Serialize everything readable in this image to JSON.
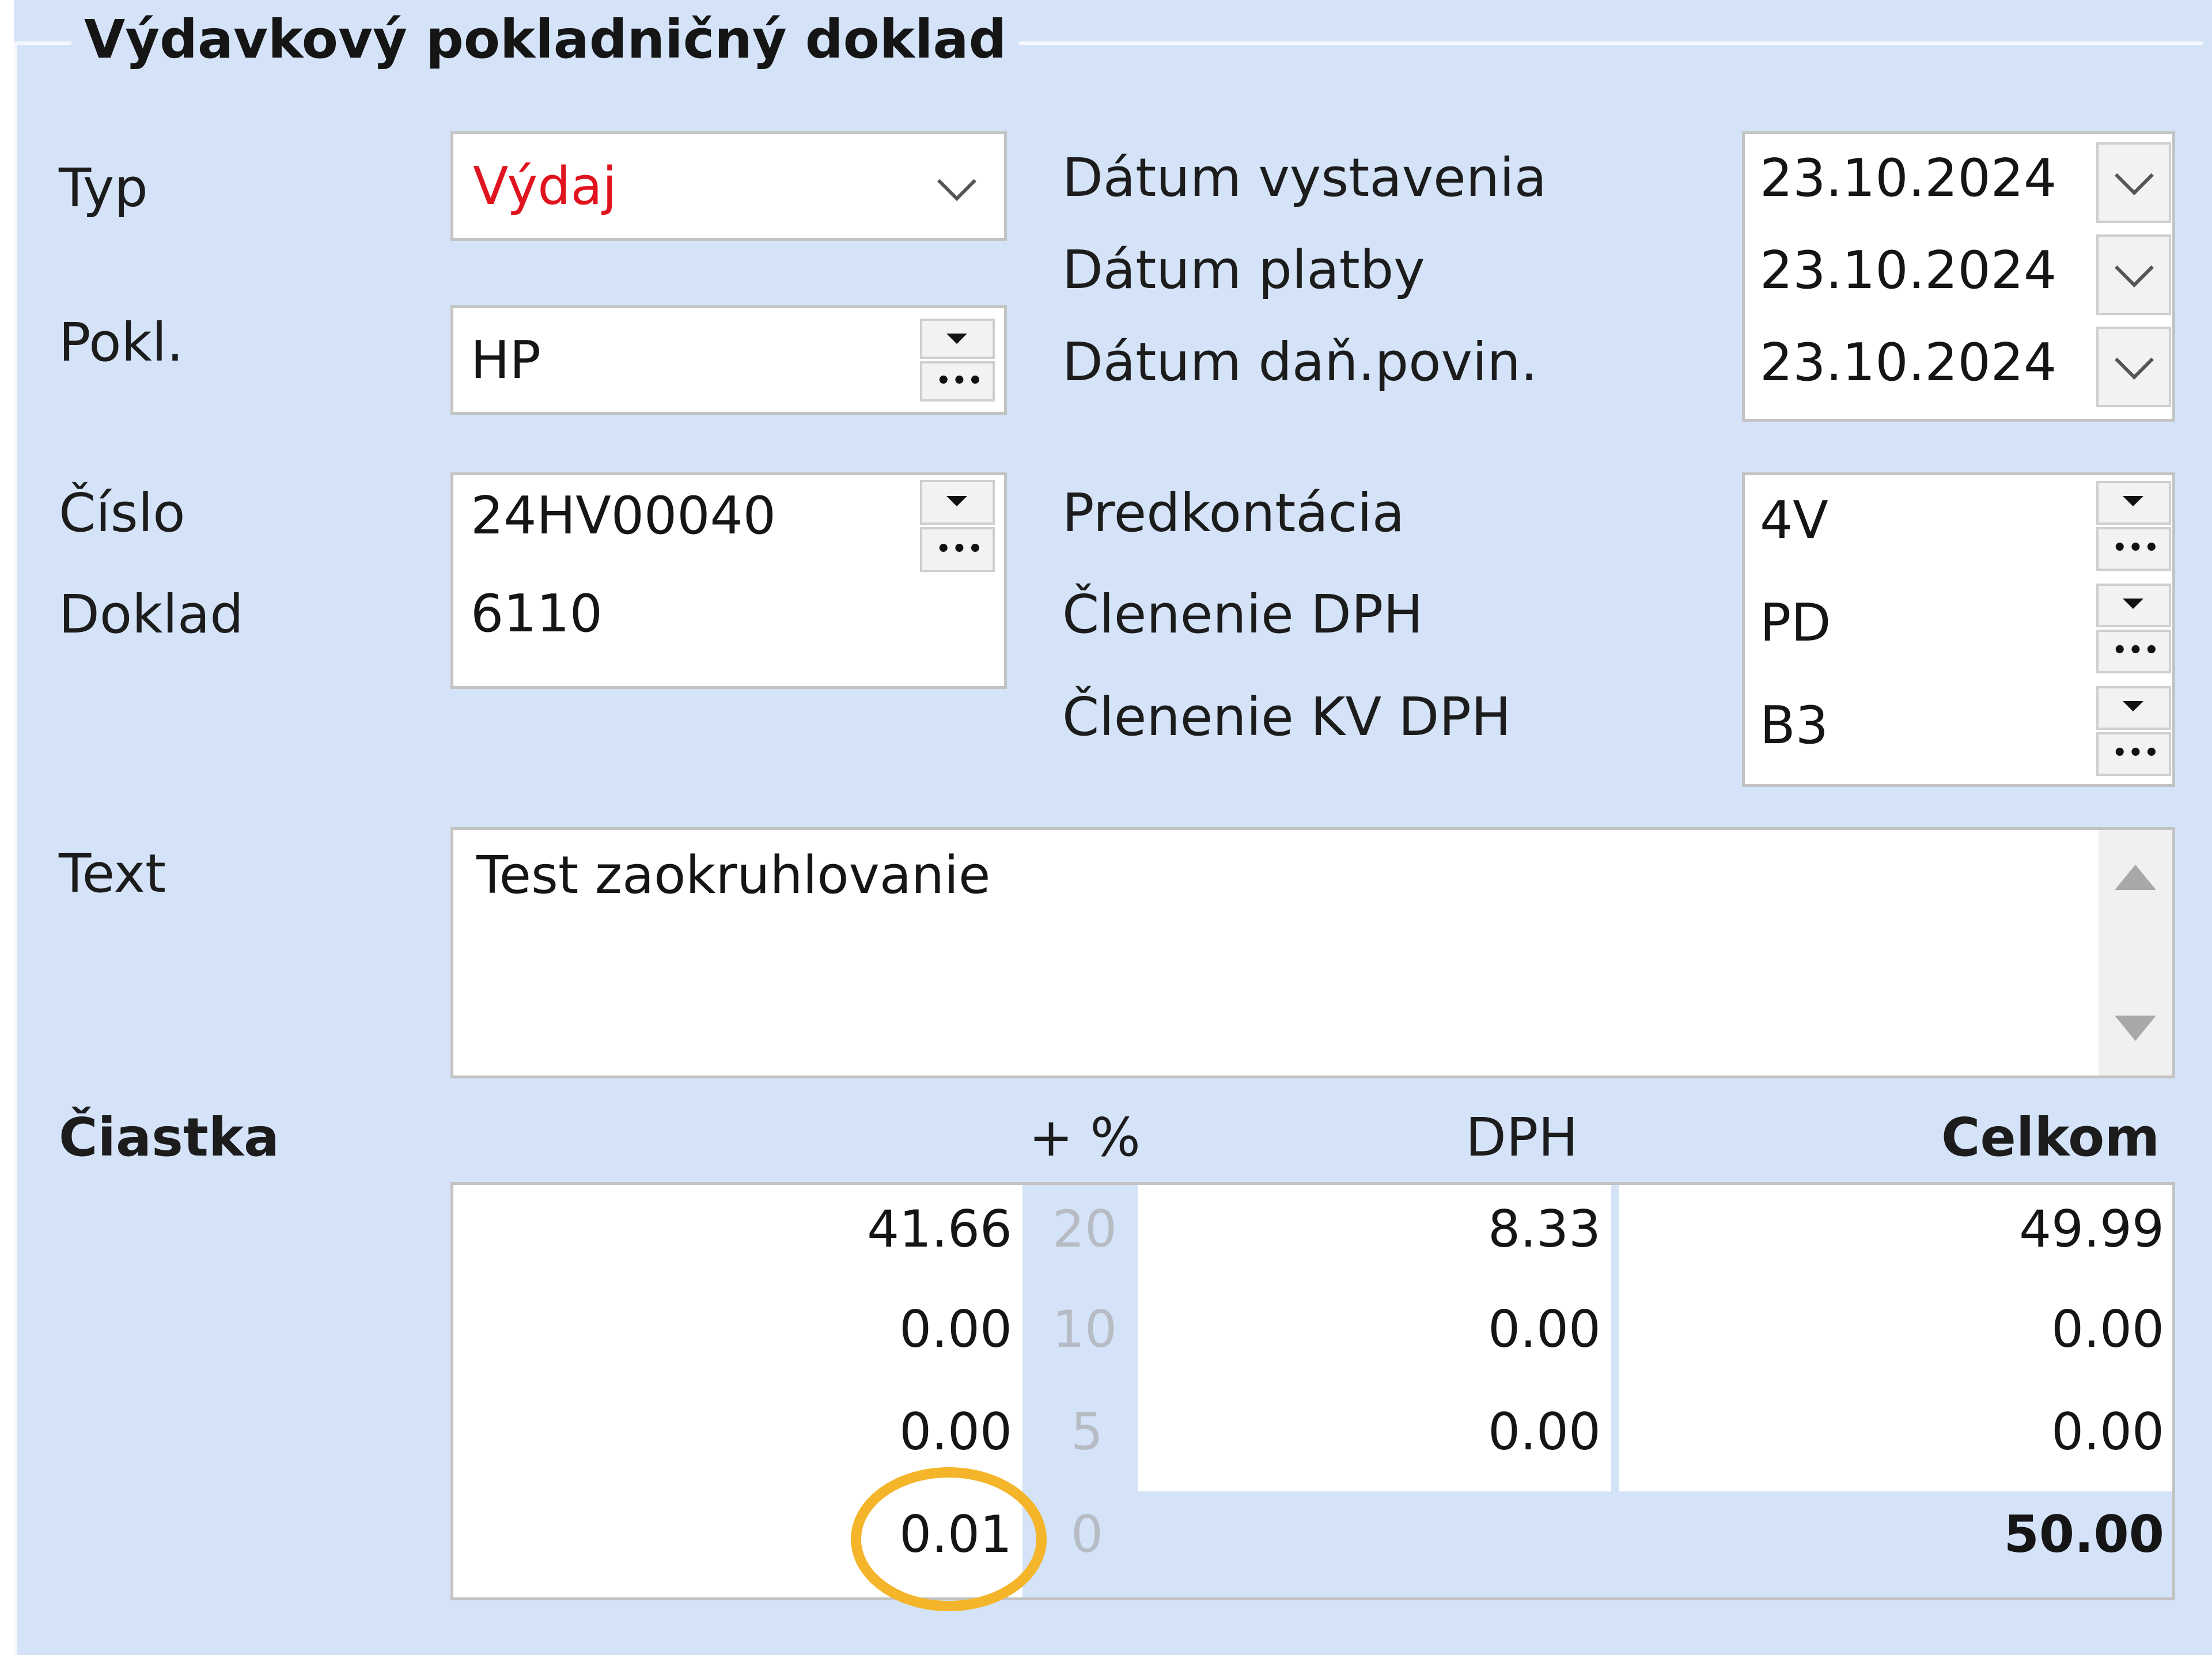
{
  "form": {
    "title": "Výdavkový pokladničný doklad",
    "labels": {
      "typ": "Typ",
      "pokl": "Pokl.",
      "cislo": "Číslo",
      "doklad": "Doklad",
      "text": "Text",
      "datum_vystavenia": "Dátum vystavenia",
      "datum_platby": "Dátum platby",
      "datum_dan_povin": "Dátum daň.povin.",
      "predkontacia": "Predkontácia",
      "clenenie_dph": "Členenie DPH",
      "clenenie_kv_dph": "Členenie KV DPH"
    },
    "values": {
      "typ": "Výdaj",
      "pokl": "HP",
      "cislo": "24HV00040",
      "doklad": "6110",
      "text": "Test zaokruhlovanie",
      "datum_vystavenia": "23.10.2024",
      "datum_platby": "23.10.2024",
      "datum_dan_povin": "23.10.2024",
      "predkontacia": "4V",
      "clenenie_dph": "PD",
      "clenenie_kv_dph": "B3"
    },
    "colors": {
      "panel": "#d4e3f8",
      "typ_value": "#e0141e",
      "highlight_ring": "#f4b52a"
    }
  },
  "amounts": {
    "headers": {
      "ciastka": "Čiastka",
      "percent": "+ %",
      "dph": "DPH",
      "celkom": "Celkom"
    },
    "rows": [
      {
        "base": "41.66",
        "rate": "20",
        "dph": "8.33",
        "total": "49.99"
      },
      {
        "base": "0.00",
        "rate": "10",
        "dph": "0.00",
        "total": "0.00"
      },
      {
        "base": "0.00",
        "rate": "5",
        "dph": "0.00",
        "total": "0.00"
      }
    ],
    "rounding": {
      "base": "0.01",
      "rate": "0"
    },
    "grand_total": "50.00"
  }
}
